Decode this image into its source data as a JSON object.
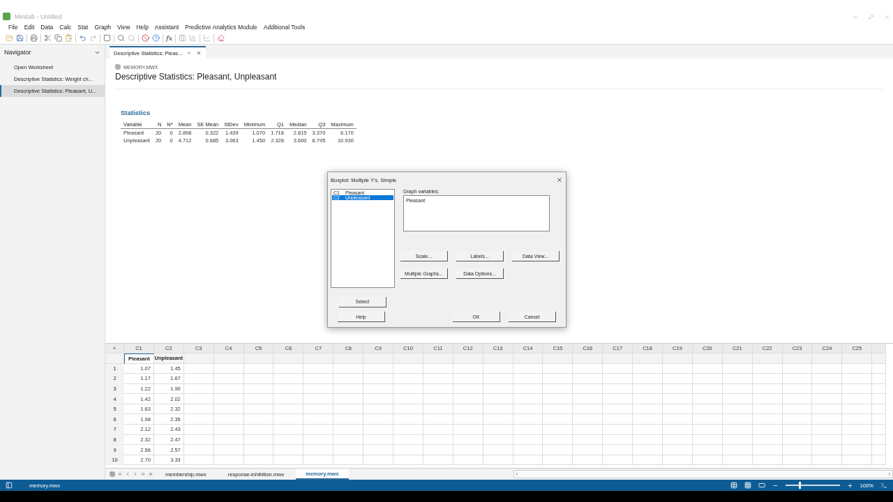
{
  "app": {
    "title": "Minitab - Untitled"
  },
  "menu": [
    "File",
    "Edit",
    "Data",
    "Calc",
    "Stat",
    "Graph",
    "View",
    "Help",
    "Assistant",
    "Predictive Analytics Module",
    "Additional Tools"
  ],
  "toolbar": {
    "fx": "fx"
  },
  "navigator": {
    "title": "Navigator",
    "items": [
      {
        "label": "Open Worksheet",
        "selected": false
      },
      {
        "label": "Descriptive Statistics: Weight ch...",
        "selected": false
      },
      {
        "label": "Descriptive Statistics: Pleasant, U...",
        "selected": true
      }
    ]
  },
  "output": {
    "tab": "Descriptive Statistics: Pleas...",
    "file": "MEMORY.MWX",
    "heading": "Descriptive Statistics: Pleasant, Unpleasant",
    "section": "Statistics",
    "table": {
      "columns": [
        "Variable",
        "N",
        "N*",
        "Mean",
        "SE Mean",
        "StDev",
        "Minimum",
        "Q1",
        "Median",
        "Q3",
        "Maximum"
      ],
      "rows": [
        [
          "Pleasant",
          "20",
          "0",
          "2.898",
          "0.322",
          "1.439",
          "1.070",
          "1.718",
          "2.815",
          "3.370",
          "6.170"
        ],
        [
          "Unpleasant",
          "20",
          "0",
          "4.712",
          "0.685",
          "3.063",
          "1.450",
          "2.328",
          "3.600",
          "6.795",
          "10.930"
        ]
      ]
    }
  },
  "dialog": {
    "title": "Boxplot: Multiple Y's, Simple",
    "variables": [
      {
        "column": "C1",
        "name": "Pleasant",
        "selected": false
      },
      {
        "column": "C2",
        "name": "Unpleasant",
        "selected": true
      }
    ],
    "graph_variables_label": "Graph variables:",
    "graph_variables_value": "Pleasant",
    "option_buttons": [
      "Scale...",
      "Labels...",
      "Data View...",
      "Multiple Graphs...",
      "Data Options..."
    ],
    "select": "Select",
    "help": "Help",
    "ok": "OK",
    "cancel": "Cancel"
  },
  "worksheet": {
    "corner": "+",
    "columns": [
      "C1",
      "C2",
      "C3",
      "C4",
      "C5",
      "C6",
      "C7",
      "C8",
      "C9",
      "C10",
      "C11",
      "C12",
      "C13",
      "C14",
      "C15",
      "C16",
      "C17",
      "C18",
      "C19",
      "C20",
      "C21",
      "C22",
      "C23",
      "C24",
      "C25"
    ],
    "names": [
      "Pleasant",
      "Unpleasant"
    ],
    "rows": [
      [
        "1",
        "1.07",
        "1.45"
      ],
      [
        "2",
        "1.17",
        "1.67"
      ],
      [
        "3",
        "1.22",
        "1.90"
      ],
      [
        "4",
        "1.42",
        "2.02"
      ],
      [
        "5",
        "1.63",
        "2.32"
      ],
      [
        "6",
        "1.98",
        "2.35"
      ],
      [
        "7",
        "2.12",
        "2.43"
      ],
      [
        "8",
        "2.32",
        "2.47"
      ],
      [
        "9",
        "2.56",
        "2.57"
      ],
      [
        "10",
        "2.70",
        "3.33"
      ]
    ]
  },
  "sheet_tabs": [
    {
      "label": "membership.mwx",
      "selected": false
    },
    {
      "label": "response-inhibition.mwx",
      "selected": false
    },
    {
      "label": "memory.mwx",
      "selected": true
    }
  ],
  "status": {
    "file": "memory.mwx",
    "zoom": "100%",
    "zoom_slider": {
      "level": 0.25
    }
  }
}
